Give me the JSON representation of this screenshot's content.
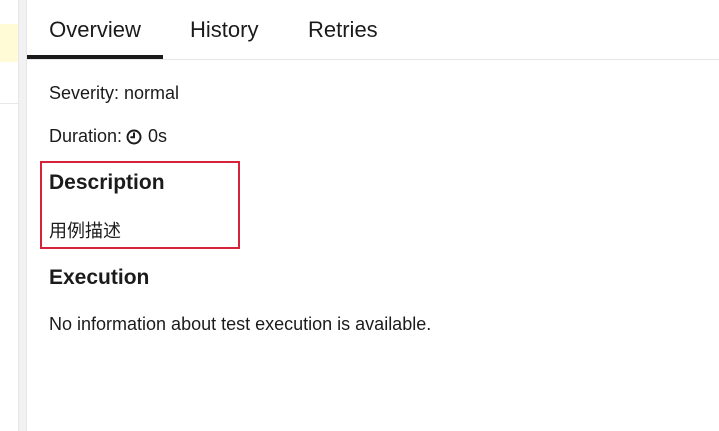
{
  "tabs": [
    {
      "label": "Overview",
      "active": true
    },
    {
      "label": "History",
      "active": false
    },
    {
      "label": "Retries",
      "active": false
    }
  ],
  "overview": {
    "severity": "Severity: normal",
    "duration_label": "Duration:",
    "duration_value": "0s",
    "description_heading": "Description",
    "description_text": "用例描述",
    "execution_heading": "Execution",
    "execution_text": "No information about test execution is available."
  },
  "icons": {
    "duration": "clock-icon"
  },
  "colors": {
    "highlight_box": "#d6233a",
    "left_highlight": "#fffbd6",
    "active_tab_underline": "#1b1b1b"
  }
}
